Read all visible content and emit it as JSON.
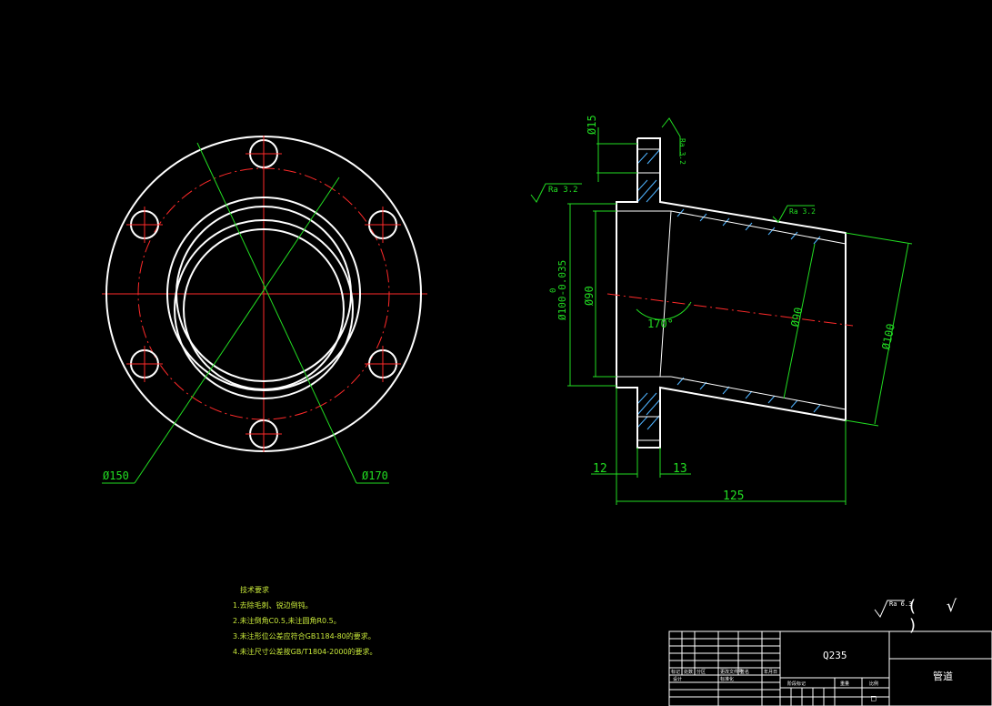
{
  "colors": {
    "background": "#000000",
    "outline": "#ffffff",
    "centerline": "#ff2a2a",
    "dimension": "#22dd22",
    "hatch": "#4fb3ff",
    "notes": "#c8e83a"
  },
  "front_view": {
    "dim_left": "Ø150",
    "dim_right": "Ø170"
  },
  "section_view": {
    "dim_hole": "Ø15",
    "dim_flange_od": "Ø100-0.035",
    "dim_flange_tol_upper": "0",
    "dim_bore": "Ø90",
    "dim_angle": "170°",
    "dim_pipe_id": "Ø90",
    "dim_pipe_od": "Ø100",
    "dim_12": "12",
    "dim_13": "13",
    "dim_125": "125",
    "roughness_1": "Ra 3.2",
    "roughness_2": "Ra 3.2",
    "roughness_3": "Ra 3.2"
  },
  "technical_notes": {
    "title": "技术要求",
    "items": [
      "1.去除毛刺、锐边倒钝。",
      "2.未注倒角C0.5,未注圆角R0.5。",
      "3.未注形位公差应符合GB1184-80的要求。",
      "4.未注尺寸公差按GB/T1804-2000的要求。"
    ]
  },
  "surface_finish": {
    "symbol_label": "Ra 6.3",
    "bracket": "( √ )"
  },
  "title_block": {
    "material": "Q235",
    "part_name": "管道",
    "row_labels": [
      "标记",
      "处数",
      "分区",
      "更改文件号",
      "签名",
      "年月日"
    ],
    "row_labels_2": [
      "设计",
      "标准化"
    ],
    "stage_labels": [
      "阶段标记",
      "重量",
      "比例"
    ],
    "stage_mark": "□"
  }
}
